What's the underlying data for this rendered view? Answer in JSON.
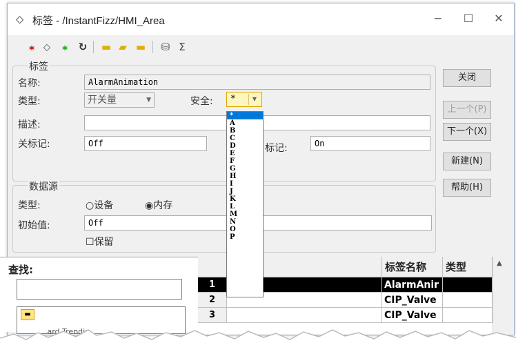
{
  "window": {
    "title": "标签 - /InstantFizz/HMI_Area",
    "minimize": "−",
    "maximize": "☐",
    "close": "✕"
  },
  "toolbar": {
    "icons": [
      "new-tag-icon",
      "tag-icon",
      "new-folder-tag-icon",
      "refresh-icon",
      "new-folder-icon",
      "open-folder-icon",
      "add-folder-icon",
      "database-icon",
      "sum-icon"
    ]
  },
  "tag_group": {
    "title": "标签",
    "name_label": "名称:",
    "name_value": "AlarmAnimation",
    "type_label": "类型:",
    "type_value": "开关量",
    "security_label": "安全:",
    "security_value": "*",
    "desc_label": "描述:",
    "desc_value": "",
    "off_label": "关标记:",
    "off_value": "Off",
    "on_label": "标记:",
    "on_value": "On"
  },
  "security_options": [
    "*",
    "A",
    "B",
    "C",
    "D",
    "E",
    "F",
    "G",
    "H",
    "I",
    "J",
    "K",
    "L",
    "M",
    "N",
    "O",
    "P"
  ],
  "data_source": {
    "title": "数据源",
    "type_label": "类型:",
    "device_option": "设备",
    "memory_option": "内存",
    "selected": "memory",
    "initial_label": "初始值:",
    "initial_value": "Off",
    "retain_label": "保留",
    "retain_checked": false
  },
  "buttons": {
    "close": "关闭",
    "prev": "上一个(P)",
    "next": "下一个(X)",
    "new": "新建(N)",
    "help": "帮助(H)"
  },
  "search": {
    "label": "查找:",
    "value": ""
  },
  "tree": {
    "partial_item": "...ard Trendin"
  },
  "grid": {
    "col_name": "标签名称",
    "col_type": "类型",
    "rows": [
      {
        "num": "1",
        "name": "AlarmAnir",
        "selected": true
      },
      {
        "num": "2",
        "name": "CIP_Valve",
        "selected": false
      },
      {
        "num": "3",
        "name": "CIP_Valve",
        "selected": false
      }
    ]
  }
}
